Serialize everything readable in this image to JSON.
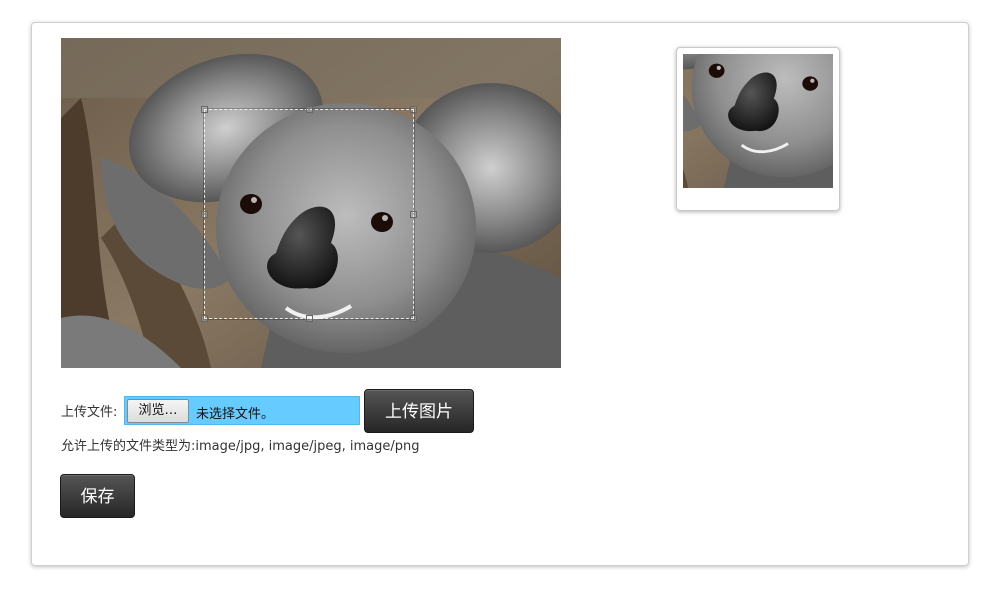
{
  "upload": {
    "label": "上传文件:",
    "browse_label": "浏览…",
    "file_status": "未选择文件。",
    "upload_button": "上传图片",
    "allowed_types_text": "允许上传的文件类型为:image/jpg, image/jpeg, image/png"
  },
  "actions": {
    "save_button": "保存"
  },
  "colors": {
    "file_input_bg": "#66ccff",
    "button_dark": "#333333"
  }
}
